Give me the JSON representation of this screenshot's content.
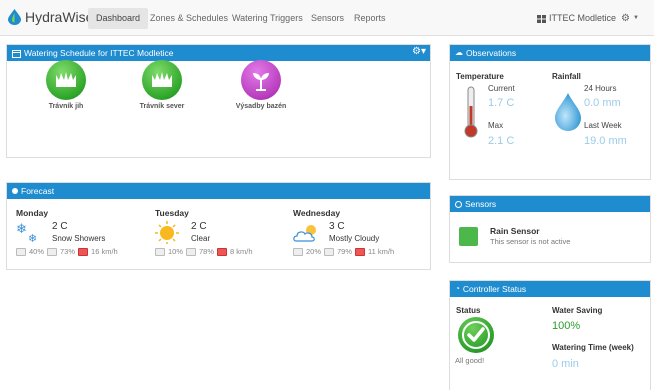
{
  "app": {
    "brand": "HydraWise"
  },
  "nav": {
    "tabs": [
      "Dashboard",
      "Zones & Schedules",
      "Watering Triggers",
      "Sensors",
      "Reports"
    ],
    "account": "ITTEC Modletice"
  },
  "schedule": {
    "title": "Watering Schedule for ITTEC Modletice",
    "zones": [
      {
        "name": "Trávník jih",
        "color": "green"
      },
      {
        "name": "Trávník sever",
        "color": "green"
      },
      {
        "name": "Výsadby bazén",
        "color": "purple"
      }
    ]
  },
  "forecast": {
    "title": "Forecast",
    "days": [
      {
        "day": "Monday",
        "temp": "2 C",
        "condition": "Snow Showers",
        "precip": "40%",
        "humidity": "73%",
        "wind": "16 km/h",
        "icon": "snow-icon"
      },
      {
        "day": "Tuesday",
        "temp": "2 C",
        "condition": "Clear",
        "precip": "10%",
        "humidity": "78%",
        "wind": "8 km/h",
        "icon": "sun-icon"
      },
      {
        "day": "Wednesday",
        "temp": "3 C",
        "condition": "Mostly Cloudy",
        "precip": "20%",
        "humidity": "79%",
        "wind": "11 km/h",
        "icon": "cloud-icon"
      }
    ]
  },
  "observations": {
    "title": "Observations",
    "temperature_label": "Temperature",
    "current_label": "Current",
    "current_value": "1.7 C",
    "max_label": "Max",
    "max_value": "2.1 C",
    "rainfall_label": "Rainfall",
    "rain24_label": "24 Hours",
    "rain24_value": "0.0 mm",
    "rainweek_label": "Last Week",
    "rainweek_value": "19.0 mm"
  },
  "sensors": {
    "title": "Sensors",
    "name": "Rain Sensor",
    "status": "This sensor is not active"
  },
  "controller": {
    "title": "Controller Status",
    "status_label": "Status",
    "status_text": "All good!",
    "water_saving_label": "Water Saving",
    "water_saving_value": "100%",
    "watering_time_label": "Watering Time (week)",
    "watering_time_value": "0 min"
  },
  "colors": {
    "header": "#1f8ccf",
    "green": "#2fa62a",
    "purple": "#b83dbe",
    "value": "#9ccbe8"
  }
}
